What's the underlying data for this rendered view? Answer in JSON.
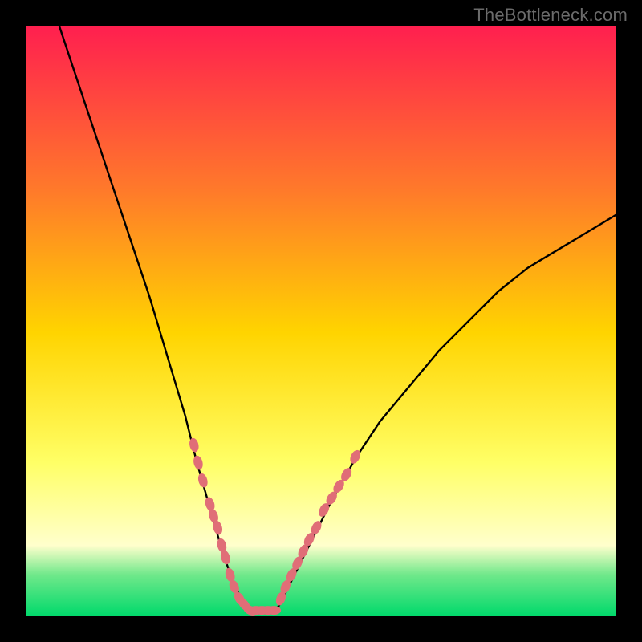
{
  "watermark": "TheBottleneck.com",
  "colors": {
    "frame_bg": "#000000",
    "grad_top": "#ff1f4f",
    "grad_mid_upper": "#ff7a2a",
    "grad_mid": "#ffd400",
    "grad_lower_yellow": "#ffff66",
    "grad_pale": "#ffffcc",
    "grad_green_top": "#6fe88a",
    "grad_green": "#00d96b",
    "curve_stroke": "#000000",
    "marker": "#e06e77"
  },
  "chart_data": {
    "type": "line",
    "title": "",
    "xlabel": "",
    "ylabel": "",
    "xlim": [
      0,
      100
    ],
    "ylim": [
      0,
      100
    ],
    "grid": false,
    "series": [
      {
        "name": "left-branch",
        "x": [
          0,
          3,
          6,
          9,
          12,
          15,
          18,
          21,
          24,
          27,
          29,
          31,
          33,
          34,
          35,
          36,
          37,
          38
        ],
        "y": [
          116,
          108,
          99,
          90,
          81,
          72,
          63,
          54,
          44,
          34,
          26,
          19,
          12,
          9,
          6,
          4,
          2,
          0.5
        ]
      },
      {
        "name": "right-branch",
        "x": [
          42,
          43,
          44,
          45,
          47,
          49,
          52,
          56,
          60,
          65,
          70,
          75,
          80,
          85,
          90,
          95,
          100
        ],
        "y": [
          0.5,
          2,
          4,
          6,
          10,
          14,
          20,
          27,
          33,
          39,
          45,
          50,
          55,
          59,
          62,
          65,
          68
        ]
      }
    ],
    "flat_bottom": {
      "x_from": 38,
      "x_to": 42,
      "y": 0.5
    },
    "markers_left": [
      {
        "x": 28.5,
        "y": 29
      },
      {
        "x": 29.2,
        "y": 26
      },
      {
        "x": 30.0,
        "y": 23
      },
      {
        "x": 31.2,
        "y": 19
      },
      {
        "x": 31.8,
        "y": 17
      },
      {
        "x": 32.5,
        "y": 15
      },
      {
        "x": 33.2,
        "y": 12
      },
      {
        "x": 33.8,
        "y": 10
      },
      {
        "x": 34.6,
        "y": 7
      },
      {
        "x": 35.3,
        "y": 5
      },
      {
        "x": 36.2,
        "y": 3
      },
      {
        "x": 37.0,
        "y": 2
      },
      {
        "x": 38.0,
        "y": 1
      },
      {
        "x": 39.0,
        "y": 1
      },
      {
        "x": 40.0,
        "y": 1
      },
      {
        "x": 41.0,
        "y": 1
      },
      {
        "x": 42.0,
        "y": 1
      }
    ],
    "markers_right": [
      {
        "x": 43.2,
        "y": 3
      },
      {
        "x": 44.0,
        "y": 5
      },
      {
        "x": 45.0,
        "y": 7
      },
      {
        "x": 46.0,
        "y": 9
      },
      {
        "x": 47.0,
        "y": 11
      },
      {
        "x": 48.0,
        "y": 13
      },
      {
        "x": 49.2,
        "y": 15
      },
      {
        "x": 50.5,
        "y": 18
      },
      {
        "x": 51.8,
        "y": 20
      },
      {
        "x": 53.0,
        "y": 22
      },
      {
        "x": 54.3,
        "y": 24
      },
      {
        "x": 55.8,
        "y": 27
      }
    ]
  }
}
